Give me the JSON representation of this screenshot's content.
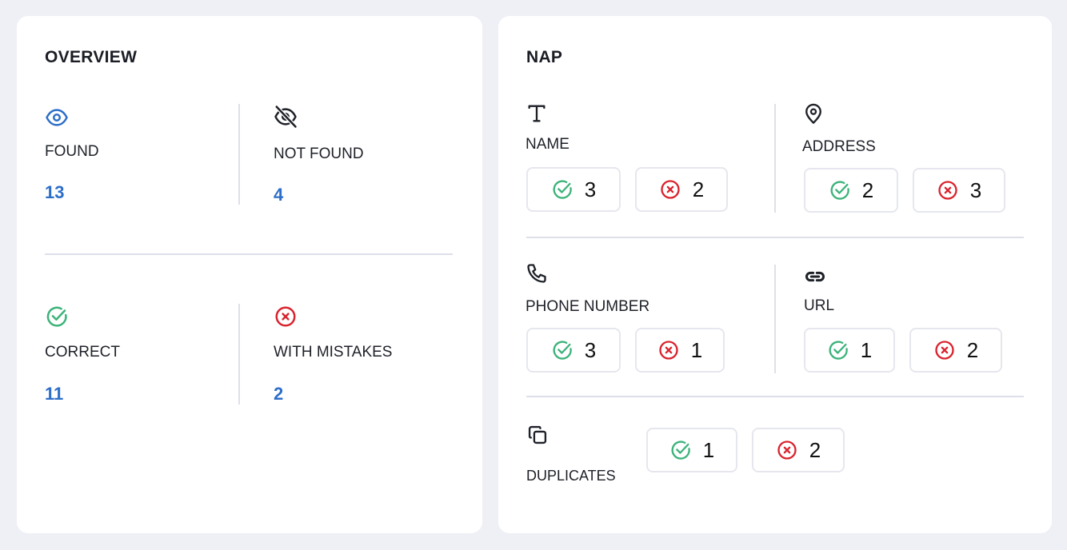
{
  "colors": {
    "accent_blue": "#2d6ec9",
    "success_green": "#3cb37a",
    "error_red": "#d9232e",
    "background": "#eff0f6"
  },
  "overview": {
    "title": "OVERVIEW",
    "stats": [
      {
        "id": "found",
        "icon": "eye-icon",
        "label": "FOUND",
        "value": "13"
      },
      {
        "id": "not-found",
        "icon": "eye-off-icon",
        "label": "NOT FOUND",
        "value": "4"
      },
      {
        "id": "correct",
        "icon": "check-circle-icon",
        "label": "CORRECT",
        "value": "11"
      },
      {
        "id": "with-mistakes",
        "icon": "x-circle-icon",
        "label": "WITH MISTAKES",
        "value": "2"
      }
    ]
  },
  "nap": {
    "title": "NAP",
    "items": [
      {
        "id": "name",
        "icon": "text-icon",
        "label": "NAME",
        "correct": "3",
        "mistakes": "2"
      },
      {
        "id": "address",
        "icon": "map-pin-icon",
        "label": "ADDRESS",
        "correct": "2",
        "mistakes": "3"
      },
      {
        "id": "phone",
        "icon": "phone-icon",
        "label": "PHONE NUMBER",
        "correct": "3",
        "mistakes": "1"
      },
      {
        "id": "url",
        "icon": "link-icon",
        "label": "URL",
        "correct": "1",
        "mistakes": "2"
      },
      {
        "id": "duplicates",
        "icon": "copy-icon",
        "label": "DUPLICATES",
        "correct": "1",
        "mistakes": "2"
      }
    ]
  }
}
